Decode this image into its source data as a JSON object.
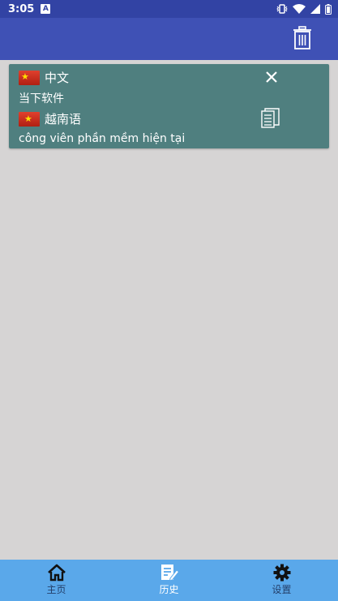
{
  "statusbar": {
    "time": "3:05",
    "notification_icon": "A"
  },
  "appbar": {
    "delete_icon": "trash-icon"
  },
  "translation": {
    "source_lang": "中文",
    "source_text": "当下软件",
    "target_lang": "越南语",
    "target_text": "công viên phần mềm hiện tại"
  },
  "bottom_nav": {
    "items": [
      {
        "label": "主页",
        "icon": "home-icon"
      },
      {
        "label": "历史",
        "icon": "history-icon",
        "active": true
      },
      {
        "label": "设置",
        "icon": "gear-icon"
      }
    ]
  }
}
